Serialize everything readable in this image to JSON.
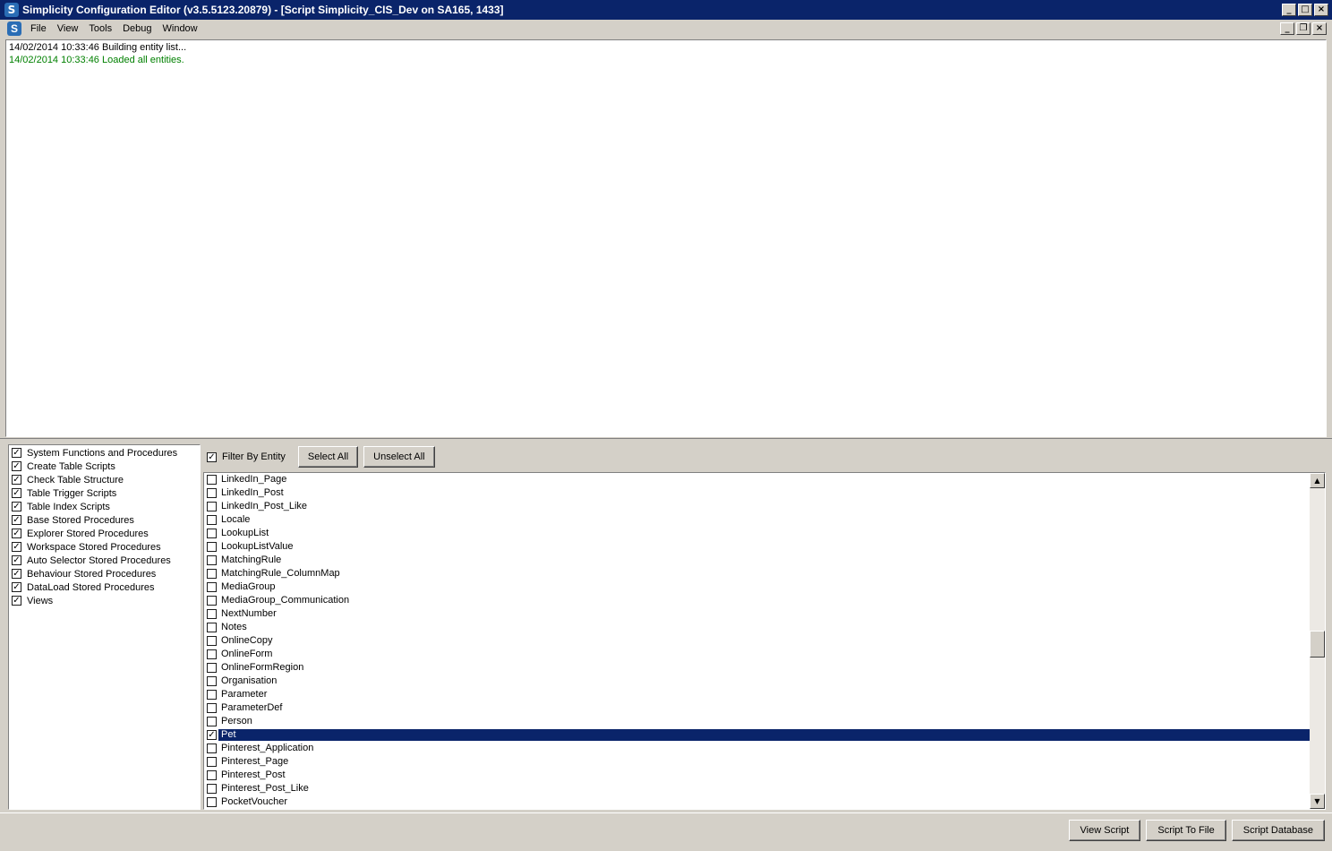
{
  "window": {
    "title": "Simplicity Configuration Editor (v3.5.5123.20879) - [Script Simplicity_CIS_Dev on SA165, 1433]",
    "icon_letter": "S"
  },
  "menu": [
    "File",
    "View",
    "Tools",
    "Debug",
    "Window"
  ],
  "log": [
    {
      "text": "14/02/2014 10:33:46 Building entity list...",
      "color": "#000000"
    },
    {
      "text": "14/02/2014 10:33:46 Loaded all entities.",
      "color": "#008000"
    }
  ],
  "script_types": [
    {
      "label": "System Functions and Procedures",
      "checked": true
    },
    {
      "label": "Create Table Scripts",
      "checked": true
    },
    {
      "label": "Check Table Structure",
      "checked": true
    },
    {
      "label": "Table Trigger Scripts",
      "checked": true
    },
    {
      "label": "Table Index Scripts",
      "checked": true
    },
    {
      "label": "Base Stored Procedures",
      "checked": true
    },
    {
      "label": "Explorer Stored Procedures",
      "checked": true
    },
    {
      "label": "Workspace Stored Procedures",
      "checked": true
    },
    {
      "label": "Auto Selector Stored Procedures",
      "checked": true
    },
    {
      "label": "Behaviour Stored Procedures",
      "checked": true
    },
    {
      "label": "DataLoad Stored Procedures",
      "checked": true
    },
    {
      "label": "Views",
      "checked": true
    }
  ],
  "filter": {
    "label": "Filter By Entity",
    "checked": true,
    "select_all": "Select All",
    "unselect_all": "Unselect All"
  },
  "entities": [
    {
      "name": "LinkedIn_Page",
      "checked": false
    },
    {
      "name": "LinkedIn_Post",
      "checked": false
    },
    {
      "name": "LinkedIn_Post_Like",
      "checked": false
    },
    {
      "name": "Locale",
      "checked": false
    },
    {
      "name": "LookupList",
      "checked": false
    },
    {
      "name": "LookupListValue",
      "checked": false
    },
    {
      "name": "MatchingRule",
      "checked": false
    },
    {
      "name": "MatchingRule_ColumnMap",
      "checked": false
    },
    {
      "name": "MediaGroup",
      "checked": false
    },
    {
      "name": "MediaGroup_Communication",
      "checked": false
    },
    {
      "name": "NextNumber",
      "checked": false
    },
    {
      "name": "Notes",
      "checked": false
    },
    {
      "name": "OnlineCopy",
      "checked": false
    },
    {
      "name": "OnlineForm",
      "checked": false
    },
    {
      "name": "OnlineFormRegion",
      "checked": false
    },
    {
      "name": "Organisation",
      "checked": false
    },
    {
      "name": "Parameter",
      "checked": false
    },
    {
      "name": "ParameterDef",
      "checked": false
    },
    {
      "name": "Person",
      "checked": false
    },
    {
      "name": "Pet",
      "checked": true,
      "selected": true
    },
    {
      "name": "Pinterest_Application",
      "checked": false
    },
    {
      "name": "Pinterest_Page",
      "checked": false
    },
    {
      "name": "Pinterest_Post",
      "checked": false
    },
    {
      "name": "Pinterest_Post_Like",
      "checked": false
    },
    {
      "name": "PocketVoucher",
      "checked": false
    }
  ],
  "actions": {
    "view_script": "View Script",
    "script_to_file": "Script To File",
    "script_database": "Script Database"
  },
  "colors": {
    "titlebar": "#0a246a",
    "selection": "#0a246a",
    "chrome": "#d4d0c8",
    "log_success": "#008000"
  }
}
